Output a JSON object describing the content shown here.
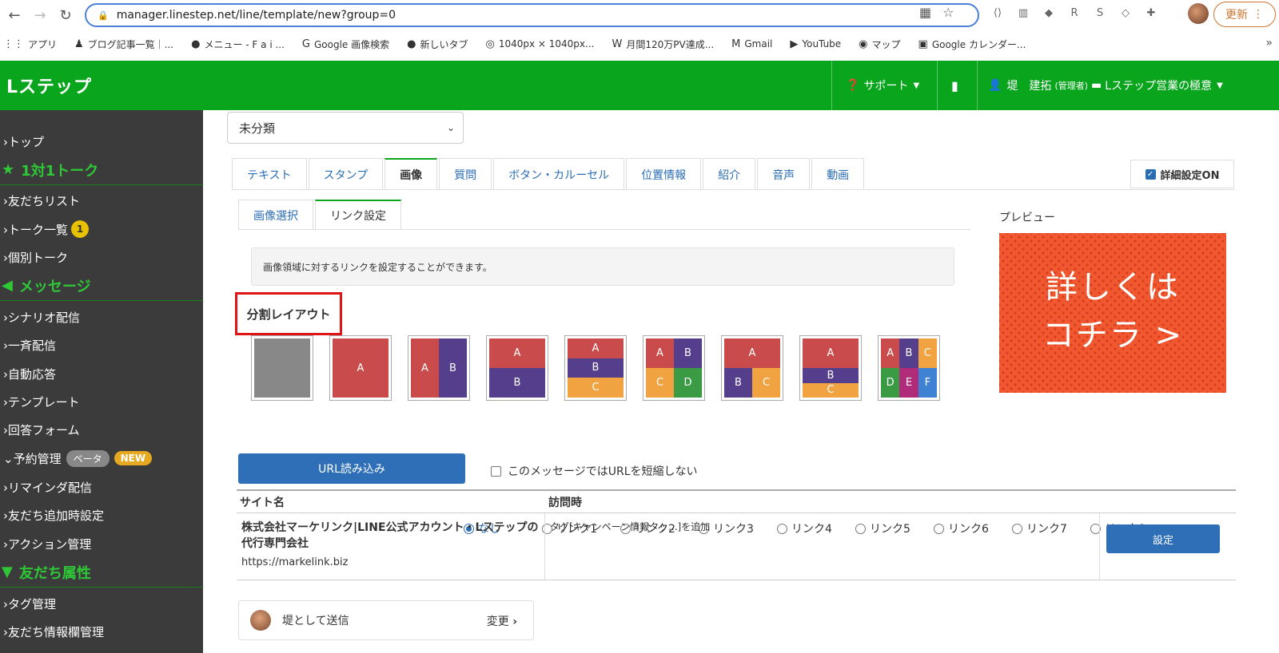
{
  "browser": {
    "url": "manager.linestep.net/line/template/new?group=0",
    "update_label": "更新",
    "bookmarks": [
      {
        "label": "アプリ",
        "icon": "apps-icon"
      },
      {
        "label": "ブログ記事一覧｜...",
        "icon": "android-icon"
      },
      {
        "label": "メニュー - F a i ...",
        "icon": "github-icon"
      },
      {
        "label": "Google 画像検索",
        "icon": "google-icon"
      },
      {
        "label": "新しいタブ",
        "icon": "github-icon"
      },
      {
        "label": "1040px × 1040px...",
        "icon": "circle-c-icon"
      },
      {
        "label": "月間120万PV達成...",
        "icon": "w-icon"
      },
      {
        "label": "Gmail",
        "icon": "gmail-icon"
      },
      {
        "label": "YouTube",
        "icon": "youtube-icon"
      },
      {
        "label": "マップ",
        "icon": "maps-icon"
      },
      {
        "label": "Google カレンダー...",
        "icon": "calendar-icon"
      }
    ],
    "bookmarks_more": "»"
  },
  "header": {
    "brand": "Lステップ",
    "support": "サポート",
    "user_name": "堤　建拓",
    "user_role": "(管理者)",
    "account": "Lステップ営業の極意"
  },
  "sidebar": {
    "items": [
      {
        "label": "›トップ",
        "type": "item"
      },
      {
        "label": "1対1トーク",
        "type": "head",
        "icon": "★"
      },
      {
        "label": "›友だちリスト",
        "type": "item"
      },
      {
        "label": "›トーク一覧",
        "type": "item",
        "badge": "1"
      },
      {
        "label": "›個別トーク",
        "type": "item"
      },
      {
        "label": "メッセージ",
        "type": "head",
        "icon": "◀"
      },
      {
        "label": "›シナリオ配信",
        "type": "item"
      },
      {
        "label": "›一斉配信",
        "type": "item"
      },
      {
        "label": "›自動応答",
        "type": "item"
      },
      {
        "label": "›テンプレート",
        "type": "item"
      },
      {
        "label": "›回答フォーム",
        "type": "item"
      },
      {
        "label": "⌄予約管理",
        "type": "item",
        "pill_beta": "ベータ",
        "pill_new": "NEW"
      },
      {
        "label": "›リマインダ配信",
        "type": "item"
      },
      {
        "label": "›友だち追加時設定",
        "type": "item"
      },
      {
        "label": "›アクション管理",
        "type": "item"
      },
      {
        "label": "友だち属性",
        "type": "head",
        "icon": "▼"
      },
      {
        "label": "›タグ管理",
        "type": "item"
      },
      {
        "label": "›友だち情報欄管理",
        "type": "item"
      }
    ]
  },
  "main": {
    "folder_select": "未分類",
    "tabs": [
      "テキスト",
      "スタンプ",
      "画像",
      "質問",
      "ボタン・カルーセル",
      "位置情報",
      "紹介",
      "音声",
      "動画"
    ],
    "active_tab": "画像",
    "detail_toggle": "詳細設定ON",
    "subtabs": [
      "画像選択",
      "リンク設定"
    ],
    "active_subtab": "リンク設定",
    "info_text": "画像領域に対するリンクを設定することができます。",
    "layout_title": "分割レイアウト",
    "layout_options": [
      "なし",
      "リンク1",
      "リンク2",
      "リンク3",
      "リンク4",
      "リンク5",
      "リンク6",
      "リンク7",
      "リンク8"
    ],
    "selected_layout": "なし",
    "preview_label": "プレビュー",
    "preview_text_line1": "詳しくは",
    "preview_text_line2": "コチラ >",
    "url_load_button": "URL読み込み",
    "no_shorten_label": "このメッセージではURLを短縮しない",
    "table": {
      "headers": [
        "サイト名",
        "訪問時"
      ],
      "row": {
        "site_name": "株式会社マーケリンク|LINE公式アカウント・Lステップの代行専門会社",
        "site_url": "https://markelink.biz",
        "visit_action": "タグ[キャンペーン情報タッ...]を追加",
        "set_button": "設定"
      }
    },
    "sender_label": "堤として送信",
    "sender_change": "変更"
  },
  "colors": {
    "brand_green": "#08a51d",
    "sidebar_bg": "#3b3b3b",
    "link_blue": "#2a6db3",
    "button_blue": "#2e6fb7",
    "highlight_red": "#e01414"
  }
}
